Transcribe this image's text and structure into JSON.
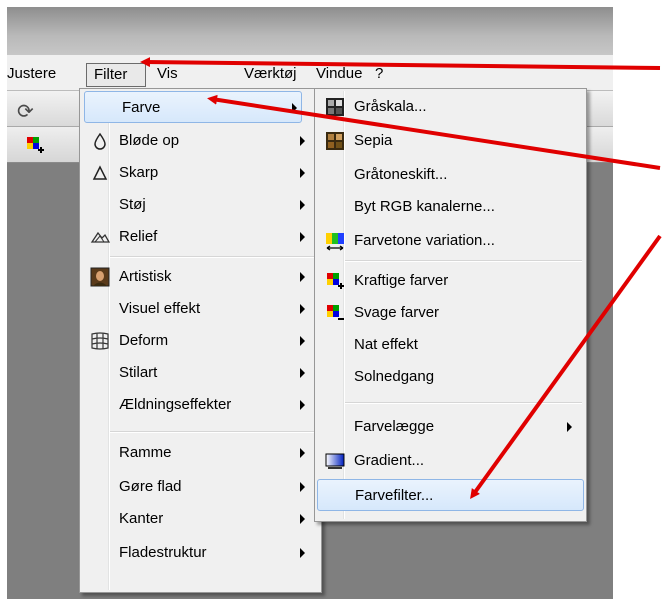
{
  "menubar": {
    "items": [
      "Justere",
      "Filter",
      "Vis",
      "Værktøj",
      "Vindue",
      "?"
    ]
  },
  "filter_menu": {
    "items": [
      {
        "label": "Farve",
        "icon": "none",
        "submenu": true,
        "highlighted": true
      },
      {
        "label": "Bløde op",
        "icon": "drop-icon",
        "submenu": true
      },
      {
        "label": "Skarp",
        "icon": "triangle-icon",
        "submenu": true
      },
      {
        "label": "Støj",
        "icon": "none",
        "submenu": true
      },
      {
        "label": "Relief",
        "icon": "relief-icon",
        "submenu": true
      },
      {
        "label": "Artistisk",
        "icon": "portrait-icon",
        "submenu": true
      },
      {
        "label": "Visuel effekt",
        "icon": "none",
        "submenu": true
      },
      {
        "label": "Deform",
        "icon": "grid-icon",
        "submenu": true
      },
      {
        "label": "Stilart",
        "icon": "none",
        "submenu": true
      },
      {
        "label": "Ældningseffekter",
        "icon": "none",
        "submenu": true
      },
      {
        "label": "Ramme",
        "icon": "none",
        "submenu": true
      },
      {
        "label": "Gøre flad",
        "icon": "none",
        "submenu": true
      },
      {
        "label": "Kanter",
        "icon": "none",
        "submenu": true
      },
      {
        "label": "Fladestruktur",
        "icon": "none",
        "submenu": true
      }
    ]
  },
  "farve_submenu": {
    "items": [
      {
        "label": "Gråskala...",
        "icon": "grayscale-grid-icon"
      },
      {
        "label": "Sepia",
        "icon": "sepia-grid-icon"
      },
      {
        "label": "Gråtoneskift...",
        "icon": "none"
      },
      {
        "label": "Byt RGB kanalerne...",
        "icon": "none"
      },
      {
        "label": "Farvetone variation...",
        "icon": "hue-variation-icon"
      },
      {
        "label": "Kraftige farver",
        "icon": "color-plus-icon"
      },
      {
        "label": "Svage farver",
        "icon": "color-minus-icon"
      },
      {
        "label": "Nat effekt",
        "icon": "none"
      },
      {
        "label": "Solnedgang",
        "icon": "none"
      },
      {
        "label": "Farvelægge",
        "icon": "none",
        "submenu": true
      },
      {
        "label": "Gradient...",
        "icon": "gradient-icon"
      },
      {
        "label": "Farvefilter...",
        "icon": "none",
        "highlighted": true
      }
    ]
  },
  "colors": {
    "annotation_arrow": "#e00000",
    "highlight": "#d6e8fb"
  }
}
